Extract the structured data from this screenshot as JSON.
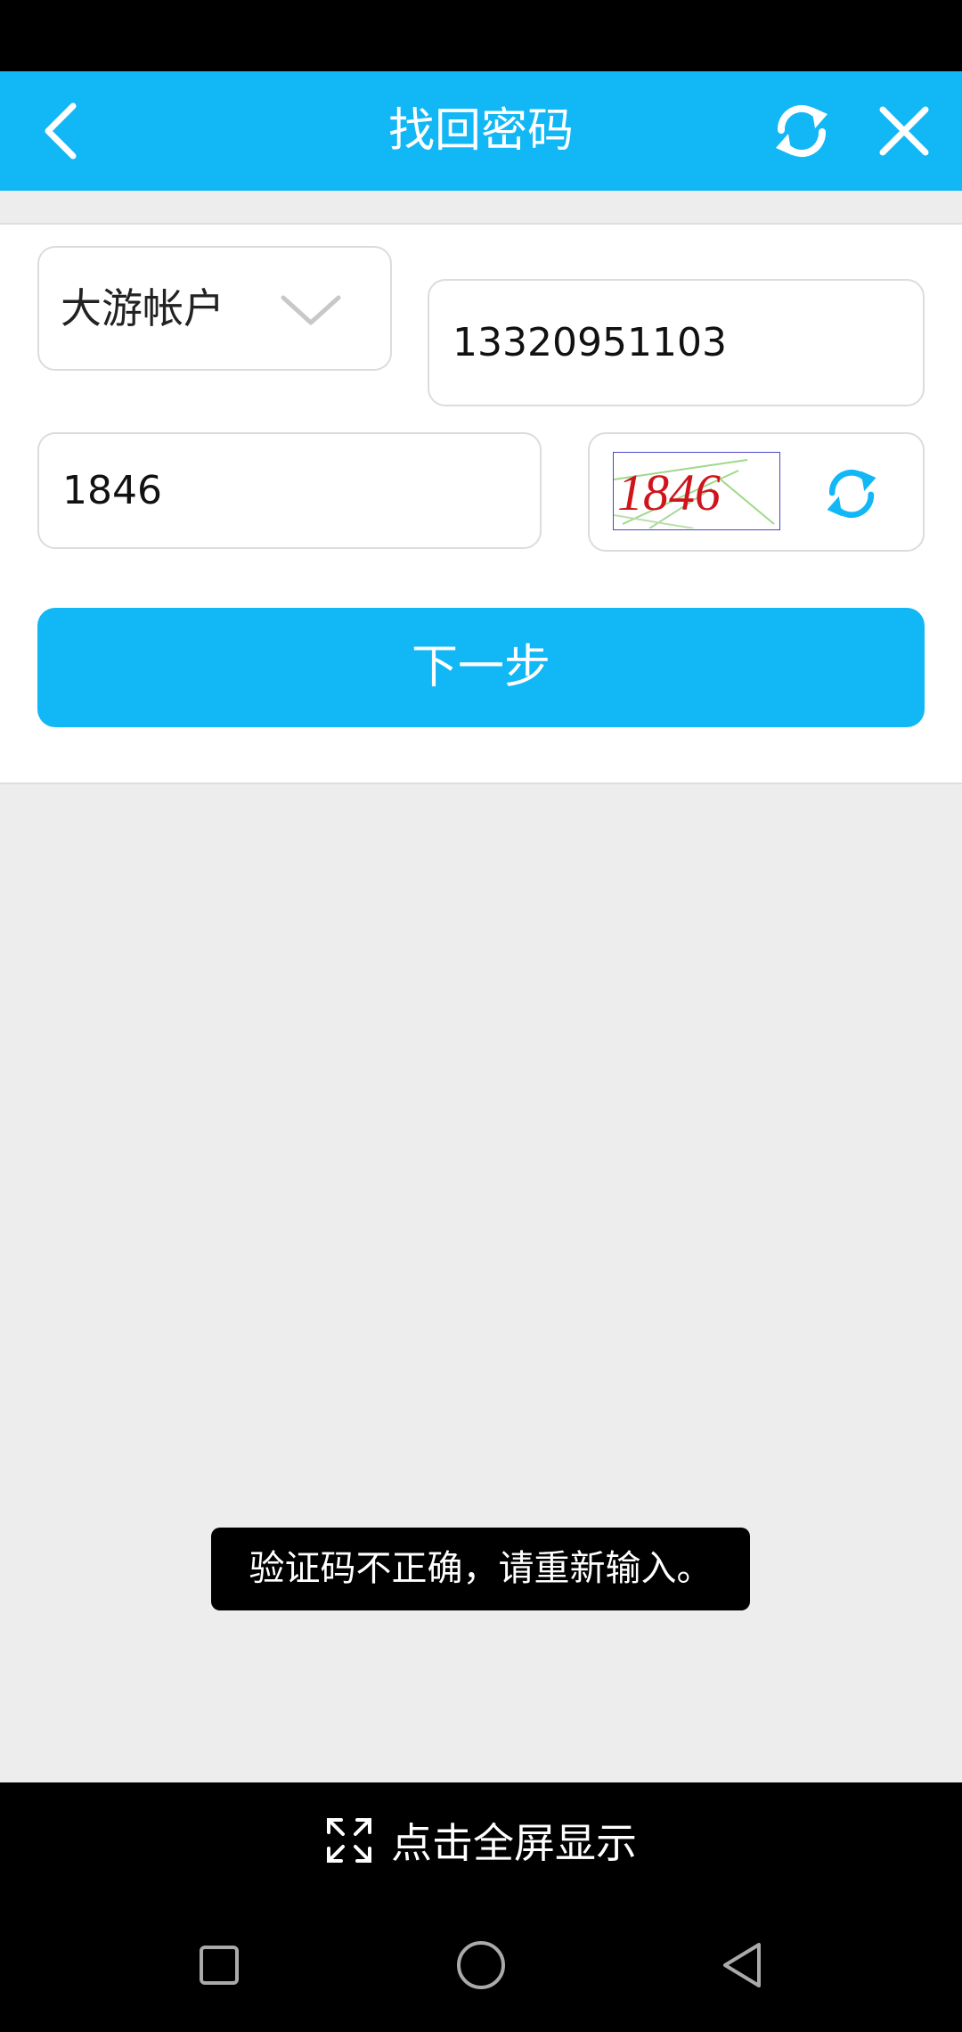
{
  "header": {
    "title": "找回密码"
  },
  "form": {
    "account_type": "大游帐户",
    "phone_value": "13320951103",
    "code_value": "1846",
    "captcha_text": "1846"
  },
  "actions": {
    "next_label": "下一步"
  },
  "toast": {
    "message": "验证码不正确，请重新输入。"
  },
  "footer": {
    "fullscreen_label": "点击全屏显示"
  },
  "colors": {
    "accent": "#12b7f5",
    "captcha_text": "#d0141c"
  }
}
